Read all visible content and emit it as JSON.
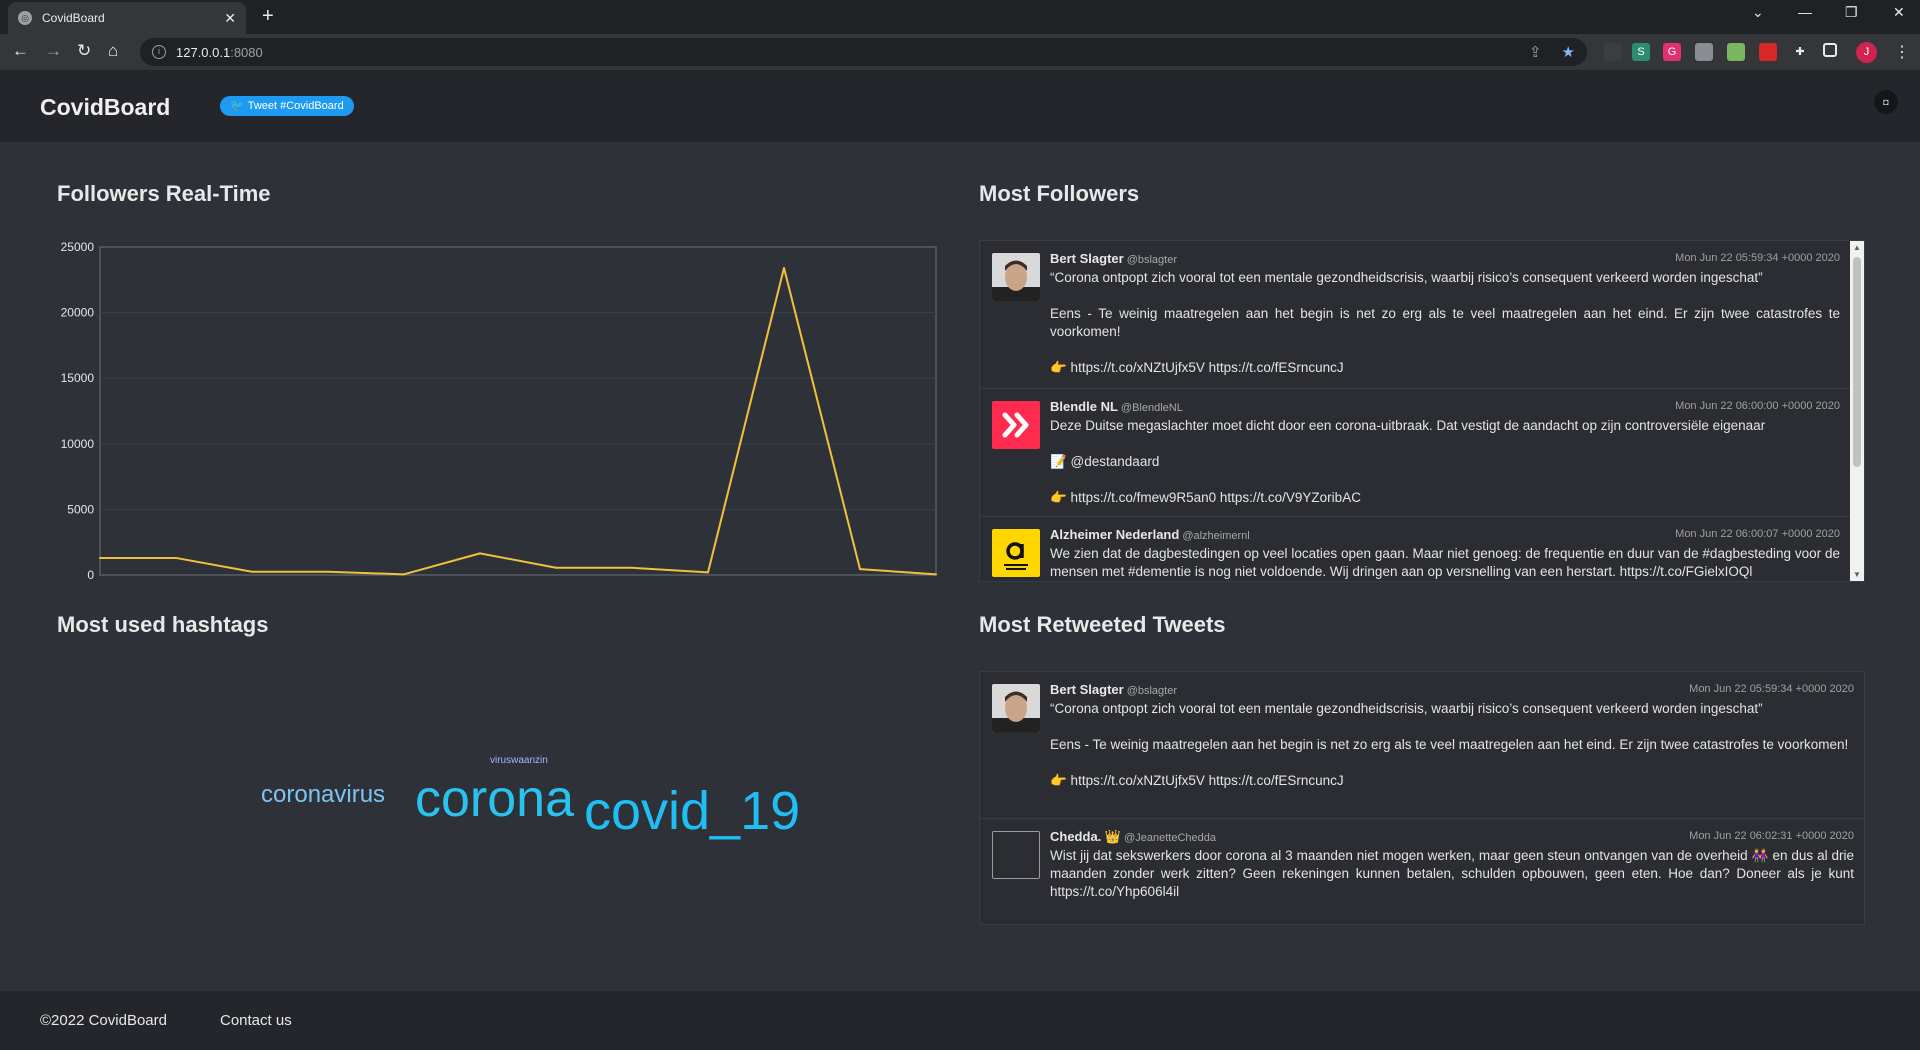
{
  "browser": {
    "tab_title": "CovidBoard",
    "url_host": "127.0.0.1",
    "url_port": ":8080",
    "profile_initial": "J"
  },
  "header": {
    "brand": "CovidBoard",
    "tweet_button": "Tweet #CovidBoard"
  },
  "sections": {
    "followers_realtime": "Followers Real-Time",
    "hashtags": "Most used hashtags",
    "most_followers": "Most Followers",
    "most_retweeted": "Most Retweeted Tweets"
  },
  "chart_data": {
    "type": "line",
    "x": [
      1,
      2,
      3,
      4,
      5,
      6,
      7,
      8,
      9,
      10,
      11,
      12
    ],
    "values": [
      1300,
      1300,
      250,
      250,
      50,
      1650,
      550,
      550,
      200,
      23400,
      450,
      50
    ],
    "ylim": [
      0,
      25000
    ],
    "yticks": [
      "0",
      "5000",
      "10000",
      "15000",
      "20000",
      "25000"
    ],
    "grid": true,
    "line_color": "#f0c23b"
  },
  "hashtags": [
    "viruswaanzin",
    "coronavirus",
    "corona",
    "covid_19"
  ],
  "most_followers": [
    {
      "name": "Bert Slagter",
      "handle": "@bslagter",
      "date": "Mon Jun 22 05:59:34 +0000 2020",
      "paragraphs": [
        "“Corona ontpopt zich vooral tot een mentale gezondheidscrisis, waarbij risico’s consequent verkeerd worden ingeschat”",
        "Eens - Te weinig maatregelen aan het begin is net zo erg als te veel maatregelen aan het eind. Er zijn twee catastrofes te voorkomen!",
        "👉 https://t.co/xNZtUjfx5V https://t.co/fESrncuncJ"
      ]
    },
    {
      "name": "Blendle NL",
      "handle": "@BlendleNL",
      "date": "Mon Jun 22 06:00:00 +0000 2020",
      "paragraphs": [
        "Deze Duitse megaslachter moet dicht door een corona-uitbraak. Dat vestigt de aandacht op zijn controversiële eigenaar",
        "📝 @destandaard",
        "👉 https://t.co/fmew9R5an0 https://t.co/V9YZoribAC"
      ]
    },
    {
      "name": "Alzheimer Nederland",
      "handle": "@alzheimernl",
      "date": "Mon Jun 22 06:00:07 +0000 2020",
      "paragraphs": [
        "We zien dat de dagbestedingen op veel locaties open gaan. Maar niet genoeg: de frequentie en duur van de #dagbesteding voor de mensen met #dementie is nog niet voldoende. Wij dringen aan op versnelling van een herstart. https://t.co/FGielxIOQl"
      ]
    }
  ],
  "most_retweeted": [
    {
      "name": "Bert Slagter",
      "handle": "@bslagter",
      "date": "Mon Jun 22 05:59:34 +0000 2020",
      "paragraphs": [
        "“Corona ontpopt zich vooral tot een mentale gezondheidscrisis, waarbij risico’s consequent verkeerd worden ingeschat”",
        "Eens - Te weinig maatregelen aan het begin is net zo erg als te veel maatregelen aan het eind. Er zijn twee catastrofes te voorkomen!",
        "👉 https://t.co/xNZtUjfx5V https://t.co/fESrncuncJ"
      ]
    },
    {
      "name": "Chedda. 👑",
      "handle": "@JeanetteChedda",
      "date": "Mon Jun 22 06:02:31 +0000 2020",
      "paragraphs": [
        "Wist jij dat sekswerkers door corona al 3 maanden niet mogen werken, maar geen steun ontvangen van de overheid 👭 en dus al drie maanden zonder werk zitten? Geen rekeningen kunnen betalen, schulden opbouwen, geen eten. Hoe dan? Doneer als je kunt https://t.co/Yhp606l4il"
      ]
    }
  ],
  "footer": {
    "copyright": "©2022 CovidBoard",
    "contact": "Contact us"
  }
}
